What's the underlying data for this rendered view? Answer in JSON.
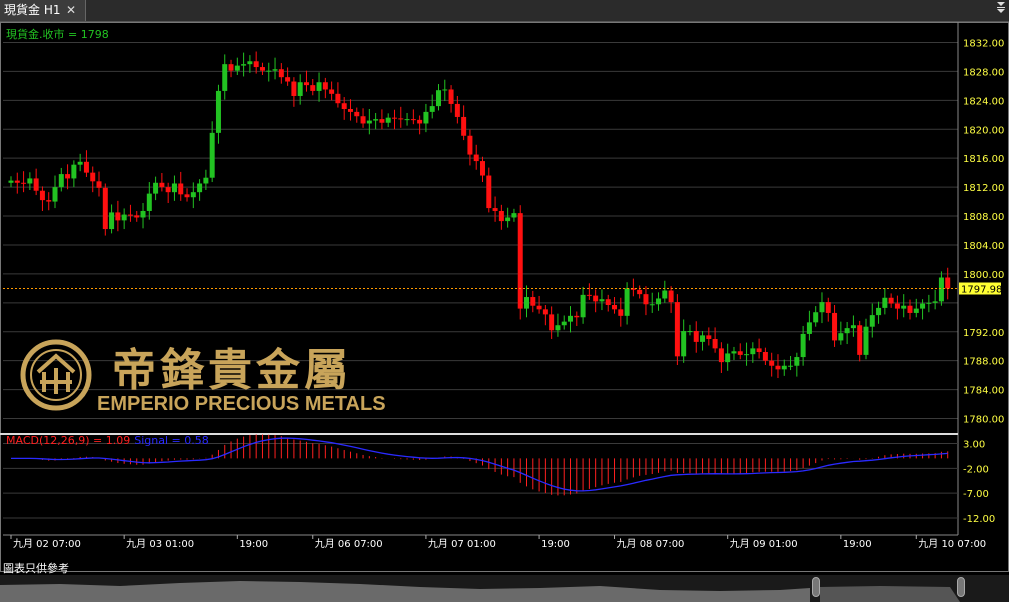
{
  "tab": {
    "title": "現貨金 H1",
    "close_label": "✕"
  },
  "menu_icon": "triangle-down-icon",
  "price_label": "現貨金.收市 = 1798",
  "macd_label": {
    "main": "MACD(12,26,9) = 1.09",
    "signal": "Signal = 0.58"
  },
  "disclaimer": "圖表只供參考",
  "logo": {
    "name_cn": "帝鋒貴金屬",
    "name_en": "EMPERIO PRECIOUS METALS"
  },
  "colors": {
    "up": "#22c322",
    "down": "#ff1010",
    "grid": "#3a3a3a",
    "axis_text": "#ffff44",
    "current": "#ff9900",
    "macd_hist": "#ff2020",
    "signal": "#2a2aff",
    "gold": "#c8a45a"
  },
  "chart_data": {
    "type": "candlestick",
    "series_name": "現貨金.收市",
    "last_price": 1797.98,
    "ylim": [
      1778,
      1834
    ],
    "y_ticks": [
      1832.0,
      1828.0,
      1824.0,
      1820.0,
      1816.0,
      1812.0,
      1808.0,
      1804.0,
      1800.0,
      1792.0,
      1788.0,
      1784.0,
      1780.0
    ],
    "y_tick_labels": [
      "1832.00",
      "1828.00",
      "1824.00",
      "1820.00",
      "1816.00",
      "1812.00",
      "1808.00",
      "1804.00",
      "1800.00",
      "1792.00",
      "1788.00",
      "1784.00",
      "1780.00"
    ],
    "x_labels": [
      "九月 02 07:00",
      "九月 03 01:00",
      "19:00",
      "九月 06 07:00",
      "九月 07 01:00",
      "19:00",
      "九月 08 07:00",
      "九月 09 01:00",
      "19:00",
      "九月 10 07:00"
    ],
    "x_label_index": [
      0,
      18,
      36,
      48,
      66,
      84,
      96,
      114,
      132,
      144
    ],
    "closes": [
      1812.9,
      1812.6,
      1812.5,
      1813.2,
      1811.5,
      1810.2,
      1810.0,
      1812.0,
      1813.8,
      1813.2,
      1815.1,
      1815.5,
      1814.0,
      1812.8,
      1811.9,
      1806.2,
      1808.5,
      1807.4,
      1808.2,
      1808.1,
      1807.8,
      1808.7,
      1811.1,
      1812.6,
      1812.0,
      1811.3,
      1812.5,
      1811.0,
      1810.6,
      1811.3,
      1812.5,
      1813.3,
      1819.5,
      1825.3,
      1829.0,
      1828.1,
      1828.8,
      1829.0,
      1829.4,
      1828.6,
      1828.1,
      1828.1,
      1828.3,
      1827.2,
      1826.6,
      1824.6,
      1826.5,
      1826.1,
      1825.3,
      1826.5,
      1825.5,
      1824.9,
      1823.6,
      1822.8,
      1822.4,
      1821.8,
      1820.8,
      1821.2,
      1821.4,
      1820.9,
      1821.6,
      1821.5,
      1821.4,
      1821.4,
      1821.3,
      1820.8,
      1822.4,
      1823.2,
      1825.4,
      1825.5,
      1823.5,
      1821.7,
      1819.1,
      1816.5,
      1815.6,
      1813.6,
      1809.1,
      1808.7,
      1807.3,
      1807.8,
      1808.4,
      1795.2,
      1796.8,
      1795.6,
      1795.1,
      1794.4,
      1792.2,
      1792.9,
      1793.4,
      1794.2,
      1794.0,
      1797.1,
      1797.0,
      1796.2,
      1796.5,
      1795.7,
      1795.1,
      1794.2,
      1798.0,
      1797.8,
      1797.2,
      1795.8,
      1795.8,
      1796.6,
      1797.7,
      1796.1,
      1788.6,
      1792.1,
      1792.1,
      1790.6,
      1791.5,
      1791.0,
      1789.7,
      1787.8,
      1789.0,
      1789.3,
      1788.8,
      1788.9,
      1789.7,
      1789.2,
      1788.0,
      1787.3,
      1786.8,
      1787.3,
      1787.3,
      1788.5,
      1791.7,
      1793.3,
      1794.7,
      1796.1,
      1794.6,
      1790.8,
      1791.8,
      1792.5,
      1792.9,
      1788.8,
      1792.7,
      1794.3,
      1795.3,
      1796.7,
      1795.9,
      1795.2,
      1795.6,
      1794.6,
      1795.2,
      1795.9,
      1796.0,
      1796.2,
      1799.5,
      1797.98
    ],
    "macd": {
      "ylim": [
        -13,
        4.5
      ],
      "y_ticks": [
        3.0,
        -2.0,
        -7.0,
        -12.0
      ],
      "y_tick_labels": [
        "3.00",
        "-2.00",
        "-7.00",
        "-12.00"
      ]
    }
  }
}
